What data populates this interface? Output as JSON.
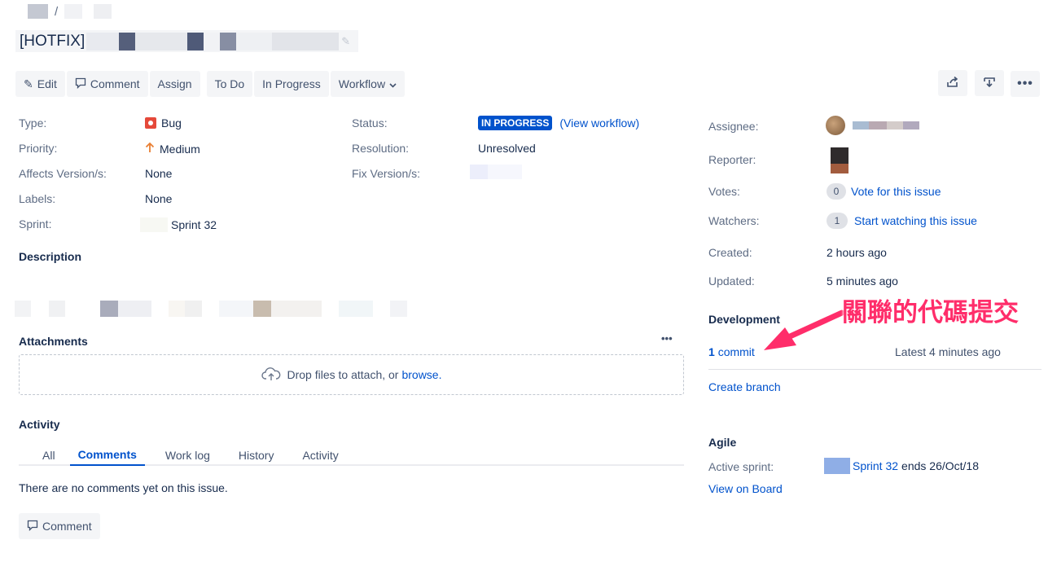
{
  "breadcrumb": {
    "separator": "/"
  },
  "issue": {
    "title_prefix": "[HOTFIX]"
  },
  "toolbar": {
    "edit": "Edit",
    "comment": "Comment",
    "assign": "Assign",
    "todo": "To Do",
    "in_progress": "In Progress",
    "workflow": "Workflow"
  },
  "details": {
    "type_label": "Type:",
    "type_value": "Bug",
    "priority_label": "Priority:",
    "priority_value": "Medium",
    "affects_label": "Affects Version/s:",
    "affects_value": "None",
    "labels_label": "Labels:",
    "labels_value": "None",
    "sprint_label": "Sprint:",
    "sprint_value": "Sprint 32",
    "status_label": "Status:",
    "status_value": "IN PROGRESS",
    "view_workflow": "(View workflow)",
    "resolution_label": "Resolution:",
    "resolution_value": "Unresolved",
    "fix_label": "Fix Version/s:"
  },
  "description": {
    "heading": "Description"
  },
  "attachments": {
    "heading": "Attachments",
    "drop_text": "Drop files to attach, or",
    "browse": "browse."
  },
  "activity": {
    "heading": "Activity",
    "tabs": [
      "All",
      "Comments",
      "Work log",
      "History",
      "Activity"
    ],
    "active_tab": "Comments",
    "empty": "There are no comments yet on this issue.",
    "comment_button": "Comment"
  },
  "people": {
    "assignee_label": "Assignee:",
    "reporter_label": "Reporter:",
    "votes_label": "Votes:",
    "votes_count": "0",
    "vote_link": "Vote for this issue",
    "watchers_label": "Watchers:",
    "watchers_count": "1",
    "watch_link": "Start watching this issue"
  },
  "dates": {
    "created_label": "Created:",
    "created_value": "2 hours ago",
    "updated_label": "Updated:",
    "updated_value": "5 minutes ago"
  },
  "development": {
    "heading": "Development",
    "commit_count": "1",
    "commit_text": "commit",
    "latest": "Latest 4 minutes ago",
    "create_branch": "Create branch"
  },
  "agile": {
    "heading": "Agile",
    "active_sprint_label": "Active sprint:",
    "sprint_link": "Sprint 32",
    "sprint_ends": "ends 26/Oct/18",
    "view_board": "View on Board"
  },
  "annotation": {
    "text": "關聯的代碼提交",
    "color": "#ff2d6a"
  },
  "colors": {
    "link": "#0052cc",
    "lozenge": "#0052cc",
    "bug": "#e5493a",
    "priority": "#e97f33"
  }
}
